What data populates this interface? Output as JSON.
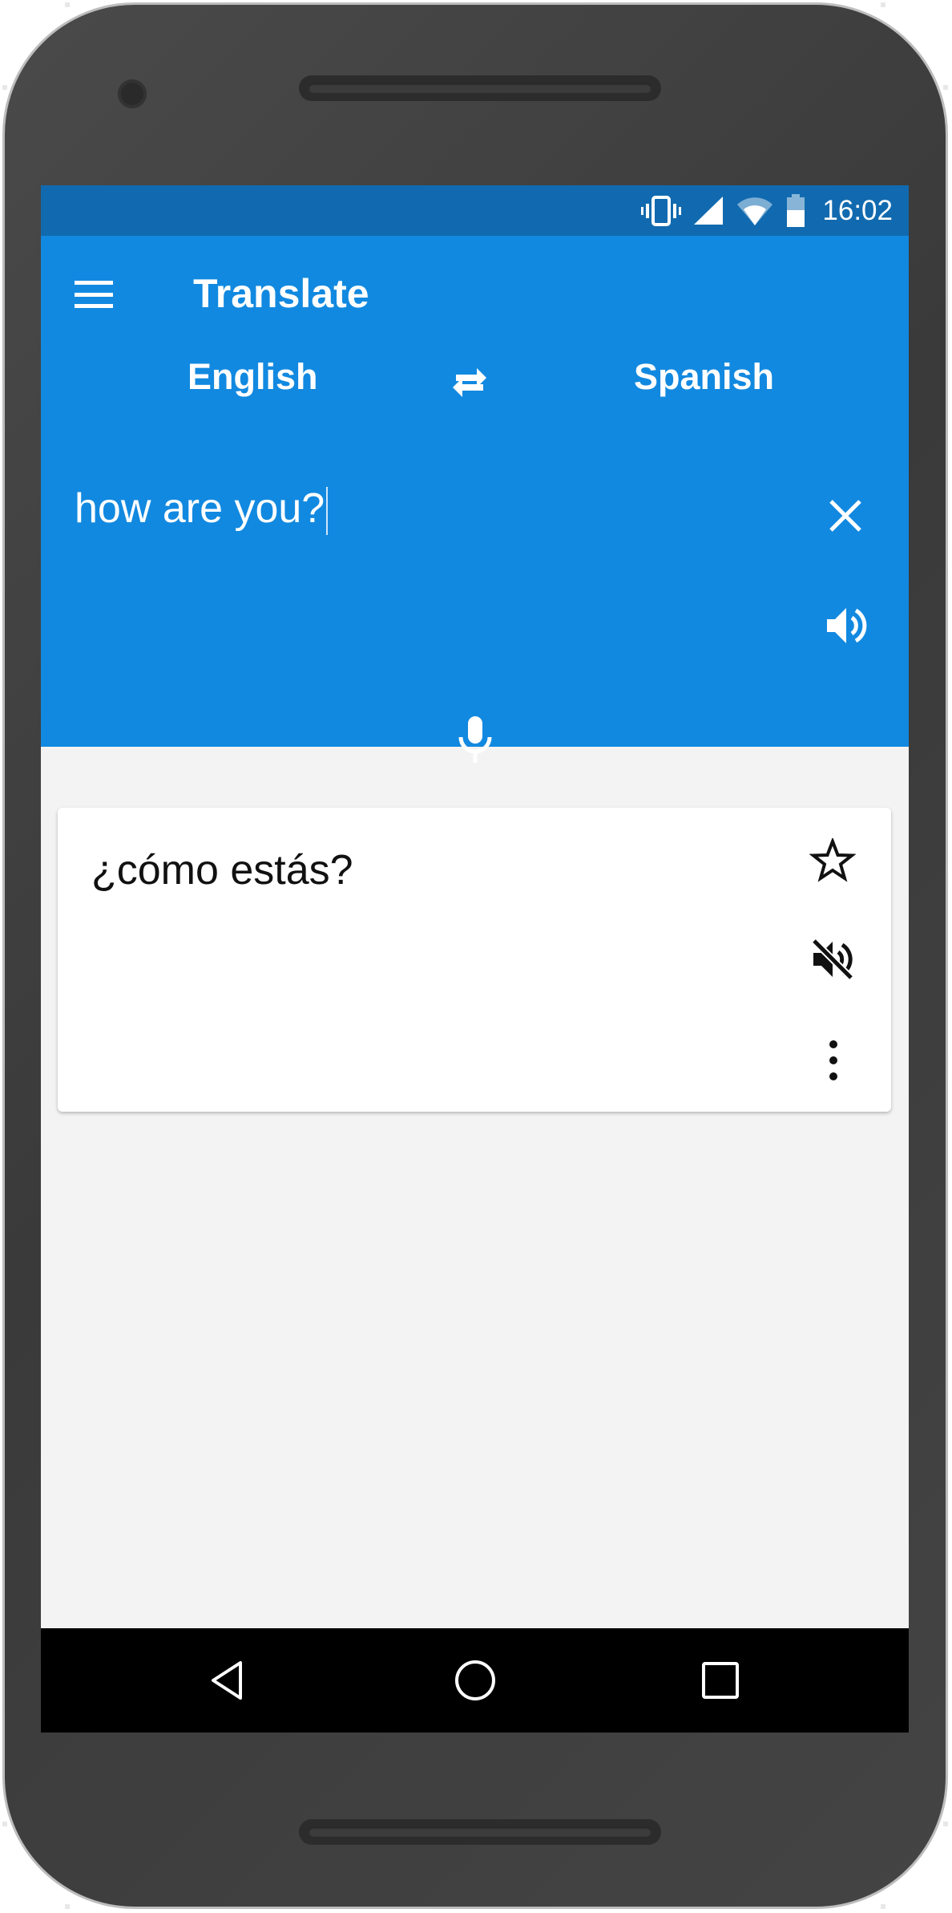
{
  "status_bar": {
    "time": "16:02",
    "icons": [
      "vibrate-icon",
      "signal-icon",
      "wifi-icon",
      "battery-icon"
    ]
  },
  "app_bar": {
    "title": "Translate",
    "menu_icon": "menu-icon"
  },
  "languages": {
    "source": "English",
    "target": "Spanish",
    "swap_icon": "swap-icon"
  },
  "input": {
    "value": "how are you?",
    "clear_icon": "close-icon",
    "speak_icon": "volume-up-icon",
    "mic_icon": "microphone-icon"
  },
  "result": {
    "text": "¿cómo estás?",
    "icons": [
      "star-icon",
      "volume-off-icon",
      "more-vert-icon"
    ]
  },
  "navigation": {
    "icons": [
      "back-icon",
      "home-icon",
      "recents-icon"
    ]
  },
  "colors": {
    "status_bar": "#116aaf",
    "app_bar": "#1289e0",
    "background": "#f3f3f3",
    "card": "#ffffff",
    "nav_bar": "#000000"
  }
}
